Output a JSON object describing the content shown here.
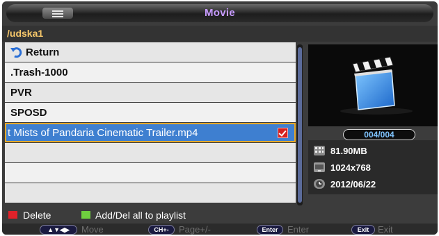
{
  "title": "Movie",
  "path": "/udska1",
  "files": [
    {
      "label": "Return",
      "type": "return"
    },
    {
      "label": ".Trash-1000",
      "type": "folder"
    },
    {
      "label": "PVR",
      "type": "folder"
    },
    {
      "label": "SPOSD",
      "type": "folder"
    },
    {
      "label": "t Mists of Pandaria Cinematic Trailer.mp4",
      "type": "file",
      "selected": true,
      "checked": true
    }
  ],
  "counter": "004/004",
  "info": {
    "size": "81.90MB",
    "resolution": "1024x768",
    "date": "2012/06/22"
  },
  "legend": {
    "delete": "Delete",
    "add_del": "Add/Del all to playlist",
    "red": "#e0222a",
    "green": "#6fcf3f"
  },
  "footer": {
    "move_key": "▲▼◀▶",
    "move": "Move",
    "page_key": "CH+-",
    "page": "Page+/-",
    "enter_key": "Enter",
    "enter": "Enter",
    "exit_key": "Exit",
    "exit": "Exit"
  },
  "colors": {
    "title": "#c79bff",
    "path": "#f6c76a",
    "selection": "#3e7fd0",
    "counter": "#7fc4ff"
  }
}
